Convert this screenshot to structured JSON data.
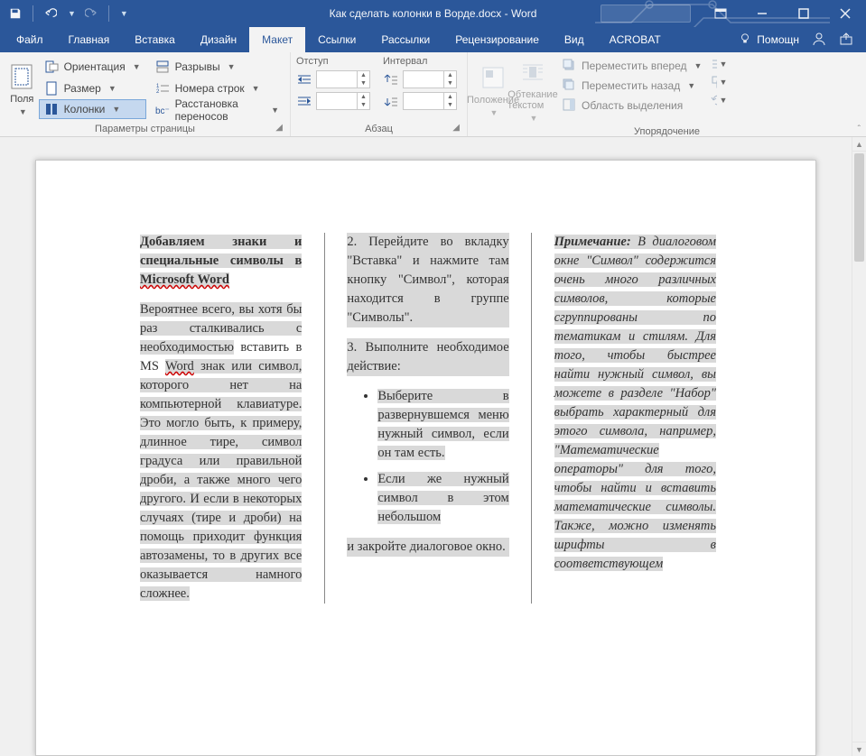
{
  "title": "Как сделать колонки в Ворде.docx - Word",
  "qat": {
    "save": "save",
    "undo": "undo",
    "redo": "redo"
  },
  "tabs": {
    "items": [
      "Файл",
      "Главная",
      "Вставка",
      "Дизайн",
      "Макет",
      "Ссылки",
      "Рассылки",
      "Рецензирование",
      "Вид",
      "ACROBAT"
    ],
    "active_index": 4,
    "help": "Помощн"
  },
  "ribbon": {
    "page_setup": {
      "margins": "Поля",
      "orientation": "Ориентация",
      "size": "Размер",
      "columns": "Колонки",
      "breaks": "Разрывы",
      "line_numbers": "Номера строк",
      "hyphenation": "Расстановка переносов",
      "group_label": "Параметры страницы"
    },
    "paragraph": {
      "indent_label": "Отступ",
      "spacing_label": "Интервал",
      "indent_left": "",
      "indent_right": "",
      "space_before": "",
      "space_after": "",
      "group_label": "Абзац"
    },
    "arrange": {
      "position": "Положение",
      "wrap": "Обтекание текстом",
      "bring_forward": "Переместить вперед",
      "send_backward": "Переместить назад",
      "selection_pane": "Область выделения",
      "group_label": "Упорядочение"
    }
  },
  "document": {
    "col1_title_a": "Добавляем знаки и специальные символы в ",
    "col1_title_link": "Microsoft Word",
    "col1_p1_a": "Вероятнее всего, вы хотя бы раз сталкивались с необходимостью",
    "col1_p1_b": " вставить в MS ",
    "col1_p1_word": "Word",
    "col1_p1_c": " знак или символ, которого нет на компьютерной клавиатуре. Это могло быть, к примеру, длинное тире, символ градуса или правильной дроби, а также много чего другого. И если в некоторых случаях (тире и дроби) на помощь приходит функция автозамены, то в других все оказывается намного сложнее.",
    "col2_p1": "2. Перейдите во вкладку \"Вставка\" и нажмите там кнопку \"Символ\", которая находится в группе \"Символы\".",
    "col2_p2": "3. Выполните необходимое действие:",
    "col2_li1": "Выберите в развернувшемся меню нужный символ, если он там есть.",
    "col2_li2": "Если же нужный символ в этом небольшом",
    "col3_top": "и закройте диалоговое окно.",
    "col3_note_label": "Примечание:",
    "col3_note_body": " В диалоговом окне \"Символ\" содержится очень много различных символов, которые сгруппированы по тематикам и стилям. Для того, чтобы быстрее найти нужный символ, вы можете в разделе \"Набор\" выбрать характерный для этого символа, например, \"Математические операторы\" для того, чтобы найти и вставить математические символы. Также, можно изменять шрифты в соответствующем"
  }
}
